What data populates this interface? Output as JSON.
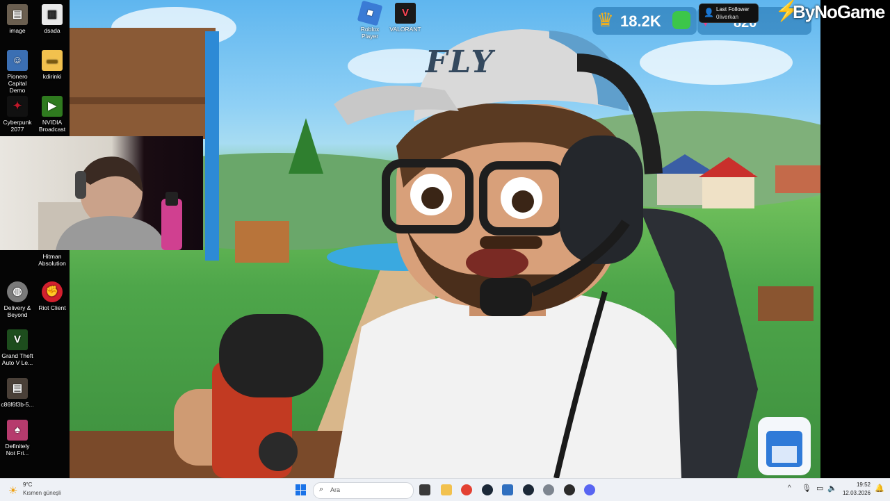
{
  "desktop_left": {
    "icons": [
      {
        "label": "image",
        "icon": "image-thumbnail-icon",
        "color": "#6b5f50"
      },
      {
        "label": "dsada",
        "icon": "document-icon",
        "color": "#e9e9e9"
      },
      {
        "label": "Pionero Capital Demo",
        "icon": "app-avatar-icon",
        "color": "#3b6fb3"
      },
      {
        "label": "kdirinki",
        "icon": "folder-icon",
        "color": "#f2c14e"
      },
      {
        "label": "Cyberpunk 2077",
        "icon": "cyberpunk-icon",
        "color": "#c0182a"
      },
      {
        "label": "NVIDIA Broadcast",
        "icon": "nvidia-icon",
        "color": "#2f7a1f"
      },
      {
        "label": "Hitman Absolution",
        "icon": "hitman-icon",
        "color": "#8a1010"
      },
      {
        "label": "Delivery & Beyond",
        "icon": "globe-icon",
        "color": "#7a7a7a"
      },
      {
        "label": "Riot Client",
        "icon": "riot-icon",
        "color": "#d3202e"
      },
      {
        "label": "Grand Theft Auto V Le...",
        "icon": "gta-icon",
        "color": "#1d4d1d"
      },
      {
        "label": "c86f6f3b-5...",
        "icon": "image-thumbnail-icon",
        "color": "#4a4038"
      },
      {
        "label": "Definitely Not Fri...",
        "icon": "game-icon",
        "color": "#b63b6d"
      }
    ]
  },
  "desktop_top": {
    "icons": [
      {
        "label": "Roblox Player",
        "icon": "roblox-icon",
        "color": "#3a7bd5"
      },
      {
        "label": "VALORANT",
        "icon": "valorant-icon",
        "color": "#ff4655"
      }
    ]
  },
  "overlay": {
    "trophy_count": "18.2K",
    "heart_count": "820",
    "last_follower_title": "Last Follower",
    "last_follower_name": "0liverkan",
    "watermark": "ByNoGame",
    "cap_text": "FLY"
  },
  "taskbar": {
    "weather_temp": "9°C",
    "weather_desc": "Kısmen güneşli",
    "search_placeholder": "Ara",
    "time": "19:52",
    "date": "12.03.2026"
  }
}
